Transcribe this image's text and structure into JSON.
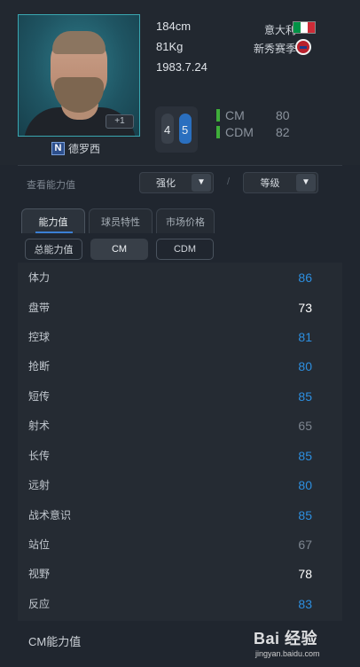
{
  "player": {
    "name": "德罗西",
    "season_badge": "N",
    "plus_badge": "+1",
    "height": "184cm",
    "weight": "81Kg",
    "birth": "1983.7.24",
    "nationality": "意大利",
    "club": "新秀赛季",
    "flag_colors": [
      "#009246",
      "#ffffff",
      "#ce2b37"
    ]
  },
  "feet": {
    "left": "4",
    "right": "5"
  },
  "positions": [
    {
      "name": "CM",
      "rating": "80"
    },
    {
      "name": "CDM",
      "rating": "82"
    }
  ],
  "controls": {
    "view_stats_label": "查看能力值",
    "enhance_label": "强化",
    "level_label": "等级",
    "separator": "/"
  },
  "tabs": [
    {
      "label": "能力值",
      "active": true
    },
    {
      "label": "球员特性",
      "active": false
    },
    {
      "label": "市场价格",
      "active": false
    }
  ],
  "subtabs": [
    {
      "label": "总能力值",
      "selected": false
    },
    {
      "label": "CM",
      "selected": true
    },
    {
      "label": "CDM",
      "selected": false
    }
  ],
  "stats": [
    {
      "name": "体力",
      "value": "86",
      "color": "#2d8fe0"
    },
    {
      "name": "盘带",
      "value": "73",
      "color": "#ffffff"
    },
    {
      "name": "控球",
      "value": "81",
      "color": "#2d8fe0"
    },
    {
      "name": "抢断",
      "value": "80",
      "color": "#2d8fe0"
    },
    {
      "name": "短传",
      "value": "85",
      "color": "#2d8fe0"
    },
    {
      "name": "射术",
      "value": "65",
      "color": "#7d858f"
    },
    {
      "name": "长传",
      "value": "85",
      "color": "#2d8fe0"
    },
    {
      "name": "远射",
      "value": "80",
      "color": "#2d8fe0"
    },
    {
      "name": "战术意识",
      "value": "85",
      "color": "#2d8fe0"
    },
    {
      "name": "站位",
      "value": "67",
      "color": "#7d858f"
    },
    {
      "name": "视野",
      "value": "78",
      "color": "#ffffff"
    },
    {
      "name": "反应",
      "value": "83",
      "color": "#2d8fe0"
    }
  ],
  "section_title": "CM能力值",
  "watermark": {
    "main": "Bai 经验",
    "sub": "jingyan.baidu.com"
  },
  "icons": {
    "dropdown": "triangle-down-icon",
    "foot": "foot-icon"
  }
}
